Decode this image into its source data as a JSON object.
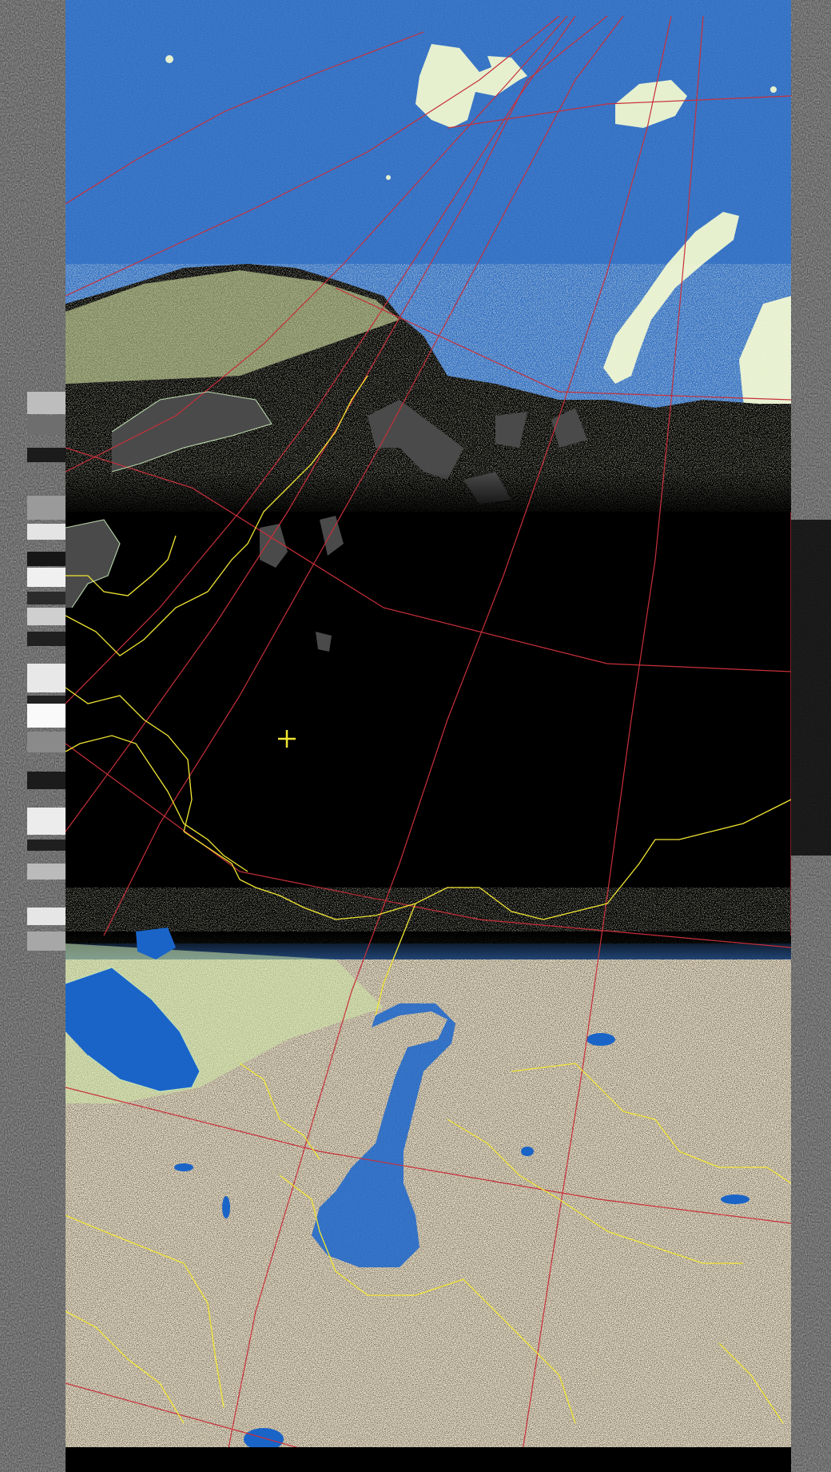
{
  "image": {
    "kind": "weather-satellite-pass",
    "palette": {
      "ocean": "#1a64c8",
      "ocean_dark": "#0b4fa8",
      "land_warm": "#f8ecd2",
      "land_vegetation": "#cfe9a6",
      "night_side": "#000000",
      "noise_strip": "#4a4a4a",
      "graticule": "#c8303a",
      "borders": "#f2e633",
      "coastline_outline": "#c9e9b8",
      "cursor": "#f2e633"
    },
    "overlays": [
      "graticule-lines",
      "country-borders",
      "coastlines",
      "center-cross-marker"
    ],
    "icons": [
      "crosshair-icon"
    ]
  }
}
